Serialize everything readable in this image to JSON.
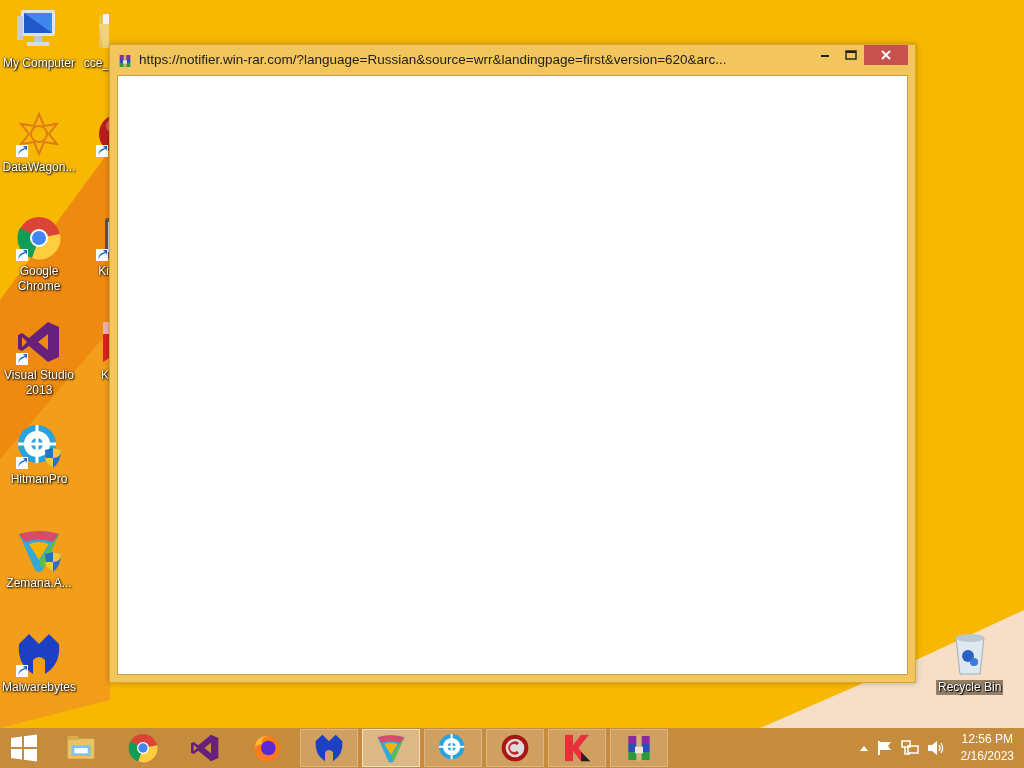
{
  "desktop_icons": [
    {
      "label": "My Computer",
      "kind": "computer",
      "shortcut": false,
      "shield": false
    },
    {
      "label": "DataWagon...",
      "kind": "star",
      "shortcut": true,
      "shield": false
    },
    {
      "label": "Google Chrome",
      "kind": "chrome",
      "shortcut": true,
      "shield": false
    },
    {
      "label": "Visual Studio 2013",
      "kind": "vs",
      "shortcut": true,
      "shield": false
    },
    {
      "label": "HitmanPro",
      "kind": "target",
      "shortcut": true,
      "shield": true
    },
    {
      "label": "Zemana.A...",
      "kind": "zemana",
      "shortcut": false,
      "shield": true
    },
    {
      "label": "Malwarebytes",
      "kind": "malware",
      "shortcut": true,
      "shield": false
    }
  ],
  "partly_hidden_icons": [
    {
      "label": "cce_",
      "kind": "folder",
      "shortcut": false
    },
    {
      "kind": "redball",
      "shortcut": true
    },
    {
      "label": "Ki",
      "kind": "device",
      "shortcut": true
    },
    {
      "label": "K",
      "kind": "redbook",
      "shortcut": false
    }
  ],
  "recycle_bin": {
    "label": "Recycle Bin"
  },
  "window": {
    "title": "https://notifier.win-rar.com/?language=Russian&source=wrr&landingpage=first&version=620&arc..."
  },
  "taskbar": {
    "items": [
      {
        "kind": "explorer",
        "running": false,
        "selected": false
      },
      {
        "kind": "chrome",
        "running": false,
        "selected": false
      },
      {
        "kind": "vs",
        "running": false,
        "selected": false
      },
      {
        "kind": "firefox",
        "running": false,
        "selected": false
      },
      {
        "kind": "malware",
        "running": true,
        "selected": false
      },
      {
        "kind": "zemana",
        "running": true,
        "selected": true
      },
      {
        "kind": "target",
        "running": true,
        "selected": false
      },
      {
        "kind": "cclean",
        "running": true,
        "selected": false
      },
      {
        "kind": "kasper",
        "running": true,
        "selected": false
      },
      {
        "kind": "winrar",
        "running": true,
        "selected": false
      }
    ],
    "time": "12:56 PM",
    "date": "2/16/2023"
  }
}
